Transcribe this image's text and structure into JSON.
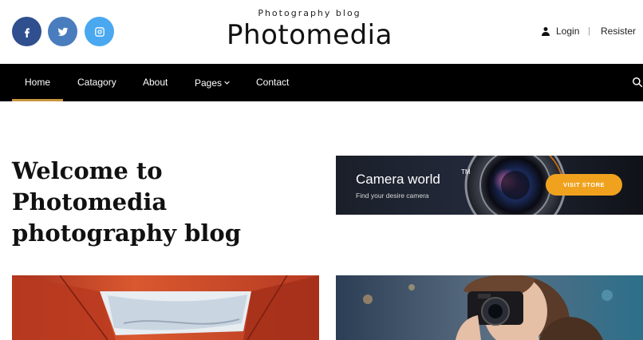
{
  "header": {
    "tagline": "Photography blog",
    "logo": "Photomedia",
    "login_label": "Login",
    "separator": "|",
    "register_label": "Resister"
  },
  "social": [
    {
      "icon": "facebook-icon",
      "glyph": "f",
      "color": "#2f4f8f"
    },
    {
      "icon": "twitter-icon",
      "color": "#4a7dbd"
    },
    {
      "icon": "instagram-icon",
      "color": "#4aa8f0"
    }
  ],
  "nav": {
    "items": [
      {
        "label": "Home",
        "active": true
      },
      {
        "label": "Catagory"
      },
      {
        "label": "About"
      },
      {
        "label": "Pages",
        "has_dropdown": true
      },
      {
        "label": "Contact"
      }
    ],
    "active_color": "#c8963e"
  },
  "hero": {
    "heading_line1": "Welcome to Photomedia",
    "heading_line2": "photography blog"
  },
  "banner": {
    "title": "Camera world",
    "trademark": "TM",
    "subtitle": "Find your desire camera",
    "button_label": "VISIT STORE",
    "button_color": "#f0a21f"
  }
}
